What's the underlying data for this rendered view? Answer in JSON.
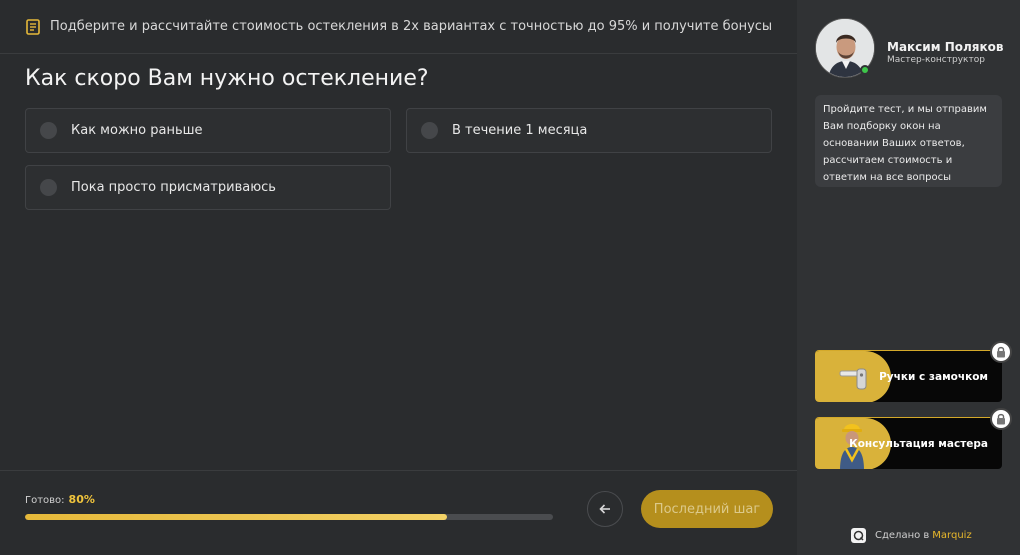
{
  "banner": {
    "text": "Подберите и рассчитайте стоимость остекления в 2х вариантах с точностью до 95% и получите бонусы",
    "icon": "note-icon"
  },
  "question": {
    "title": "Как скоро Вам нужно остекление?",
    "options": [
      {
        "label": "Как можно раньше"
      },
      {
        "label": "В течение 1 месяца"
      },
      {
        "label": "Пока просто присматриваюсь"
      }
    ]
  },
  "progress": {
    "label": "Готово:",
    "percent_text": "80%",
    "value": 0.8
  },
  "nav": {
    "next_label": "Последний шаг",
    "back_icon": "arrow-left-icon"
  },
  "manager": {
    "name": "Максим Поляков",
    "role": "Мастер-конструктор",
    "message": "Пройдите тест, и мы отправим Вам подборку окон на основании Ваших ответов, рассчитаем стоимость и ответим на все вопросы"
  },
  "bonuses": [
    {
      "label": "Ручки с замочком",
      "icon": "lock-icon"
    },
    {
      "label": "Консультация мастера",
      "icon": "lock-icon"
    }
  ],
  "footer": {
    "made_text": "Сделано в",
    "brand": "Marquiz"
  },
  "colors": {
    "accent": "#f0c43c",
    "background": "#2a2c2e",
    "sidebar": "#303234",
    "online": "#3ec64a"
  }
}
